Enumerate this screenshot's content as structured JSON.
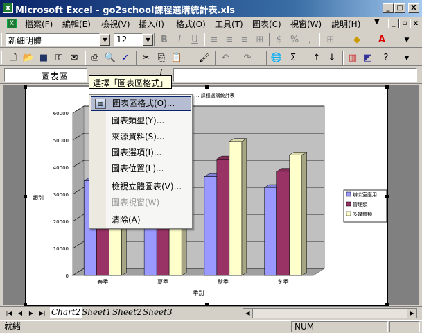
{
  "app": {
    "title": "Microsoft Excel - go2school課程選購統計表.xls",
    "app_icon": "excel-icon"
  },
  "window_controls": {
    "minimize": "_",
    "maximize": "□",
    "close": "X"
  },
  "menubar": {
    "items": [
      {
        "label": "檔案(F)"
      },
      {
        "label": "編輯(E)"
      },
      {
        "label": "檢視(V)"
      },
      {
        "label": "插入(I)"
      },
      {
        "label": "格式(O)"
      },
      {
        "label": "工具(T)"
      },
      {
        "label": "圖表(C)"
      },
      {
        "label": "視窗(W)"
      },
      {
        "label": "說明(H)"
      }
    ]
  },
  "format_toolbar": {
    "font_name": "新細明體",
    "font_size": "12"
  },
  "formula_bar": {
    "name_box": "圖表區",
    "fx": "f"
  },
  "tooltip": {
    "text": "選擇「圖表區格式」"
  },
  "context_menu": {
    "items": [
      {
        "label": "圖表區格式(O)...",
        "highlight": true,
        "icon": "format-chart-area-icon"
      },
      {
        "label": "圖表類型(Y)..."
      },
      {
        "label": "來源資料(S)..."
      },
      {
        "label": "圖表選項(I)..."
      },
      {
        "label": "圖表位置(L)..."
      },
      {
        "label": "檢視立體圖表(V)..."
      },
      {
        "label": "圖表視窗(W)",
        "disabled": true
      },
      {
        "label": "清除(A)"
      }
    ]
  },
  "chart_data": {
    "type": "bar",
    "title": "...課程選購統計表",
    "categories": [
      "春季",
      "夏季",
      "秋季",
      "冬季"
    ],
    "series": [
      {
        "name": "辦公室應用",
        "values": [
          35000,
          36000,
          36500,
          32500
        ],
        "color": "#9999ff"
      },
      {
        "name": "管理類",
        "values": [
          28000,
          29000,
          43000,
          38500
        ],
        "color": "#993366"
      },
      {
        "name": "多媒體類",
        "values": [
          30000,
          31000,
          49500,
          44500
        ],
        "color": "#ffffcc"
      }
    ],
    "xlabel": "季別",
    "ylabel": "類別",
    "ylim": [
      0,
      60000
    ],
    "yticks": [
      "0",
      "10000",
      "20000",
      "30000",
      "40000",
      "50000",
      "60000"
    ],
    "grid": true,
    "legend": "right"
  },
  "sheet_tabs": {
    "tabs": [
      {
        "label": "Chart2",
        "active": true
      },
      {
        "label": "Sheet1"
      },
      {
        "label": "Sheet2"
      },
      {
        "label": "Sheet3"
      }
    ]
  },
  "statusbar": {
    "status": "就緒",
    "num": "NUM"
  }
}
